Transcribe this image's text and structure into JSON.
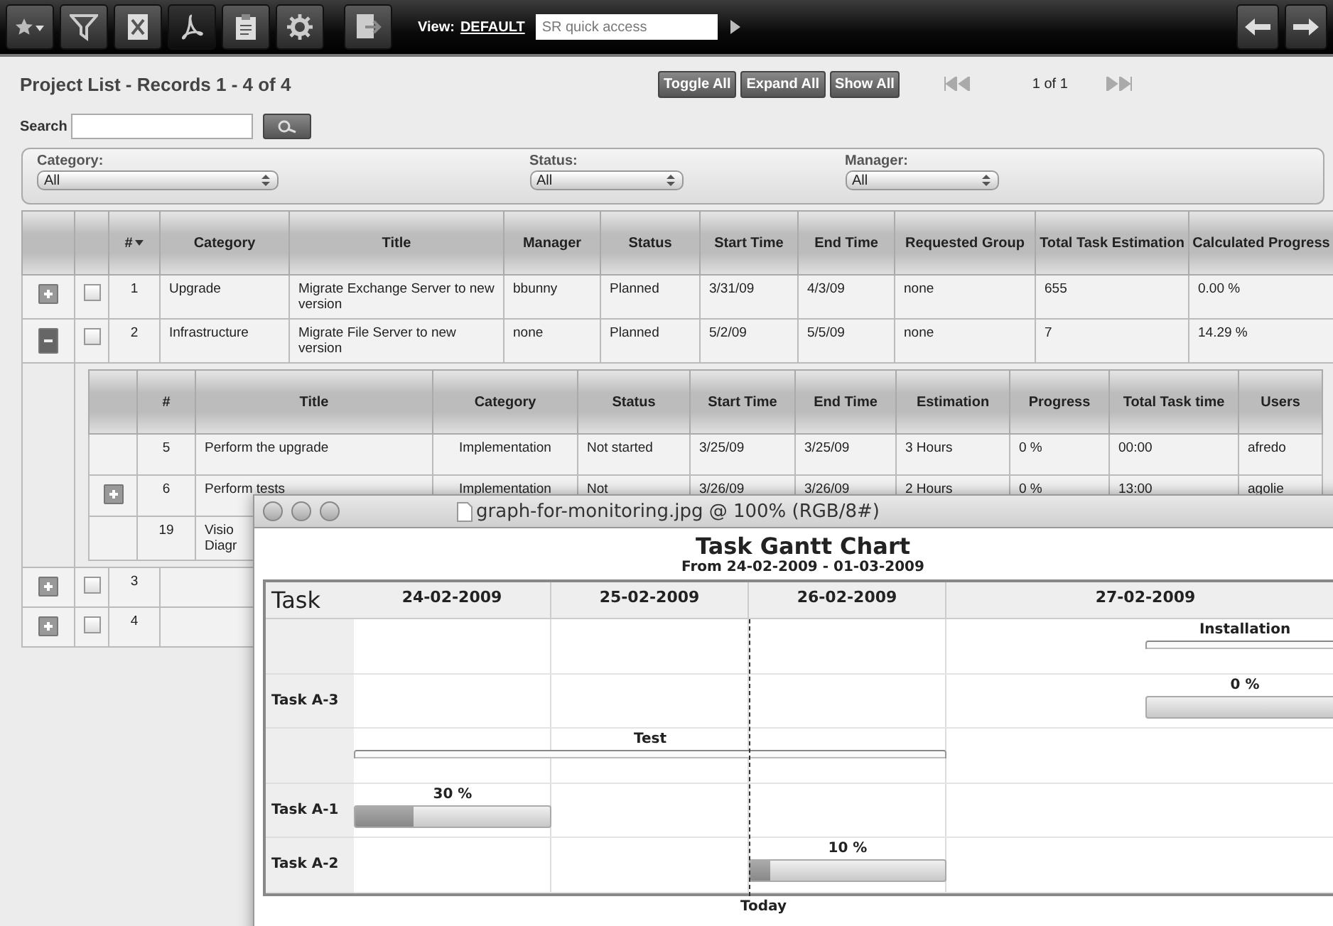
{
  "toolbar": {
    "view_label": "View:",
    "view_value": "DEFAULT",
    "quick_access": {
      "placeholder": "SR quick access"
    }
  },
  "header": {
    "title": "Project List - Records 1 - 4 of 4",
    "buttons": [
      "Toggle All",
      "Expand All",
      "Show All"
    ],
    "pager": "1 of 1"
  },
  "search": {
    "label": "Search"
  },
  "filters": [
    {
      "label": "Category:",
      "value": "All"
    },
    {
      "label": "Status:",
      "value": "All"
    },
    {
      "label": "Manager:",
      "value": "All"
    }
  ],
  "table": {
    "columns": [
      {
        "label": "#",
        "sorted": true
      },
      {
        "label": "Category",
        "sorted": false
      },
      {
        "label": "Title",
        "sorted": false
      },
      {
        "label": "Manager",
        "sorted": false
      },
      {
        "label": "Status",
        "sorted": false
      },
      {
        "label": "Start Time",
        "sorted": false
      },
      {
        "label": "End Time",
        "sorted": false
      },
      {
        "label": "Requested Group",
        "sorted": false
      },
      {
        "label": "Total Task Estimation",
        "sorted": false
      },
      {
        "label": "Calculated Progress",
        "sorted": false
      }
    ],
    "rows": [
      {
        "expanded": false,
        "checked": false,
        "cells": [
          "1",
          "Upgrade",
          "Migrate Exchange Server to new version",
          "bbunny",
          "Planned",
          "3/31/09",
          "4/3/09",
          "none",
          "655",
          "0.00 %"
        ]
      },
      {
        "expanded": true,
        "checked": false,
        "cells": [
          "2",
          "Infrastructure",
          "Migrate File Server to new version",
          "none",
          "Planned",
          "5/2/09",
          "5/5/09",
          "none",
          "7",
          "14.29 %"
        ],
        "subtable": {
          "columns": [
            "#",
            "Title",
            "Category",
            "Status",
            "Start Time",
            "End Time",
            "Estimation",
            "Progress",
            "Total Task time",
            "Users"
          ],
          "rows": [
            {
              "expandable": false,
              "cells": [
                "5",
                "Perform the upgrade",
                "Implementation",
                "Not started",
                "3/25/09",
                "3/25/09",
                "3 Hours",
                "0 %",
                "00:00",
                "afredo"
              ]
            },
            {
              "expandable": true,
              "cells": [
                "6",
                "Perform tests",
                "Implementation",
                "Not",
                "3/26/09",
                "3/26/09",
                "2 Hours",
                "0 %",
                "13:00",
                "agolie"
              ]
            },
            {
              "expandable": false,
              "cells": [
                "19",
                "Visio Diagr"
              ]
            }
          ]
        }
      },
      {
        "expanded": false,
        "checked": false,
        "cells": [
          "3"
        ]
      },
      {
        "expanded": false,
        "checked": false,
        "cells": [
          "4"
        ]
      }
    ]
  },
  "viewer": {
    "title": "graph-for-monitoring.jpg @ 100% (RGB/8#)",
    "chart": {
      "title": "Task Gantt Chart",
      "subtitle": "From 24-02-2009 - 01-03-2009",
      "task_header": "Task",
      "dates": [
        "24-02-2009",
        "25-02-2009",
        "26-02-2009",
        "27-02-2009"
      ],
      "rows": [
        {
          "kind": "summary",
          "bar_label": "Installation"
        },
        {
          "kind": "task",
          "label": "Task A-3",
          "bar_label": "0 %",
          "level": 0
        },
        {
          "kind": "summary",
          "bar_label": "Test"
        },
        {
          "kind": "task",
          "label": "Task A-1",
          "bar_label": "30 %",
          "level": 0.3
        },
        {
          "kind": "task",
          "label": "Task A-2",
          "bar_label": "10 %",
          "level": 0.1
        }
      ],
      "today_label": "Today"
    }
  }
}
